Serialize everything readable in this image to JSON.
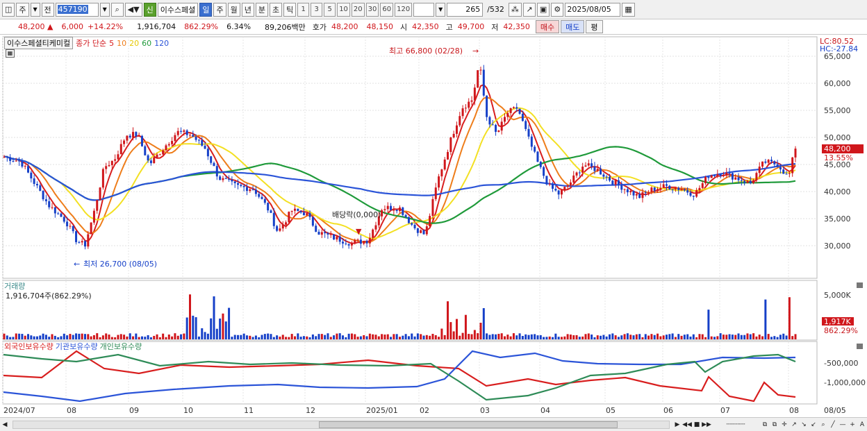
{
  "toolbar": {
    "btn_ju": "주",
    "btn_jeon": "전",
    "stock_code": "457190",
    "btn_sin": "신",
    "stock_name": "이수스페셜",
    "periods": [
      "일",
      "주",
      "월",
      "년",
      "분",
      "초",
      "틱"
    ],
    "intervals": [
      "1",
      "3",
      "5",
      "10",
      "20",
      "30",
      "60",
      "120"
    ],
    "count": "265",
    "count_total": "/532",
    "date": "2025/08/05"
  },
  "quote": {
    "price": "48,200",
    "change": "6,000",
    "change_pct": "+14.22%",
    "volume": "1,916,704",
    "volume_ratio": "862.29%",
    "turnover": "6.34%",
    "amount": "89,206백만",
    "hoga_label": "호가",
    "ask": "48,200",
    "bid": "48,150",
    "open_label": "시",
    "open": "42,350",
    "high_label": "고",
    "high": "49,700",
    "low_label": "저",
    "low": "42,350",
    "buy_label": "매수",
    "sell_label": "매도",
    "eval_label": "평"
  },
  "chart": {
    "stock_name": "이수스페셜티케미컬",
    "ma_title": "종가 단순",
    "ma_periods": [
      "5",
      "10",
      "20",
      "60",
      "120"
    ],
    "ma_colors": [
      "#d81e1e",
      "#ee7d1a",
      "#f3e023",
      "#1f9a3a",
      "#2b54d8"
    ],
    "lc": "LC:80.52",
    "hc": "HC:-27.84",
    "high_annotation": "최고 66,800 (02/28)",
    "low_annotation": "최저 26,700 (08/05)",
    "dividend_annotation": "배당락(0,000)",
    "price_ticks": [
      "65,000",
      "60,000",
      "55,000",
      "50,000",
      "45,000",
      "40,000",
      "35,000",
      "30,000"
    ],
    "current_price_label": "48,200",
    "current_pct_label": "13.55%",
    "volume_title": "거래량",
    "volume_value": "1,916,704주(862.29%)",
    "volume_tick": "5,000K",
    "volume_current": "1,917K",
    "volume_pct": "862.29%",
    "ownership_legend": [
      "외국인보유수량",
      "기관보유수량",
      "개인보유수량"
    ],
    "ownership_colors": [
      "#d81e1e",
      "#2b54d8",
      "#2e8b57"
    ],
    "ownership_ticks": [
      "-500,000",
      "-1,000,000"
    ],
    "date_labels": [
      "2024/07",
      "08",
      "09",
      "10",
      "11",
      "12",
      "2025/01",
      "02",
      "03",
      "04",
      "05",
      "06",
      "07",
      "08",
      "08/05"
    ]
  }
}
